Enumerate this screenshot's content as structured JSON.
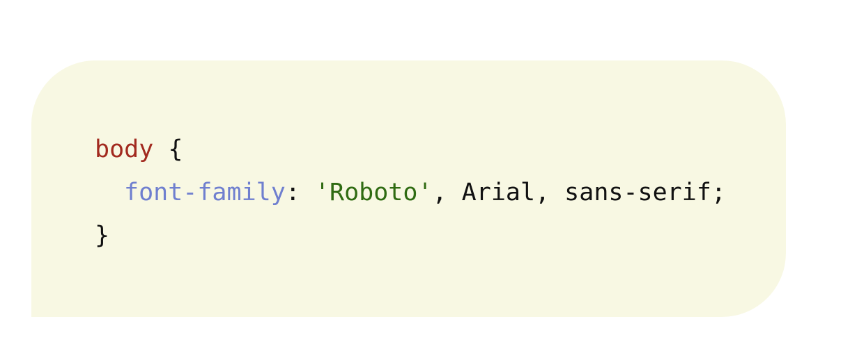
{
  "code_block": {
    "background": "#f8f8e3",
    "lines": [
      {
        "selector": "body",
        "open_brace": " {"
      },
      {
        "property": "font-family",
        "colon": ": ",
        "string": "'Roboto'",
        "rest": ", Arial, sans-serif;"
      },
      {
        "close_brace": "}"
      }
    ]
  },
  "colors": {
    "selector": "#a22a1f",
    "property": "#6f7fcf",
    "string": "#2f6b12",
    "plain": "#111111"
  }
}
